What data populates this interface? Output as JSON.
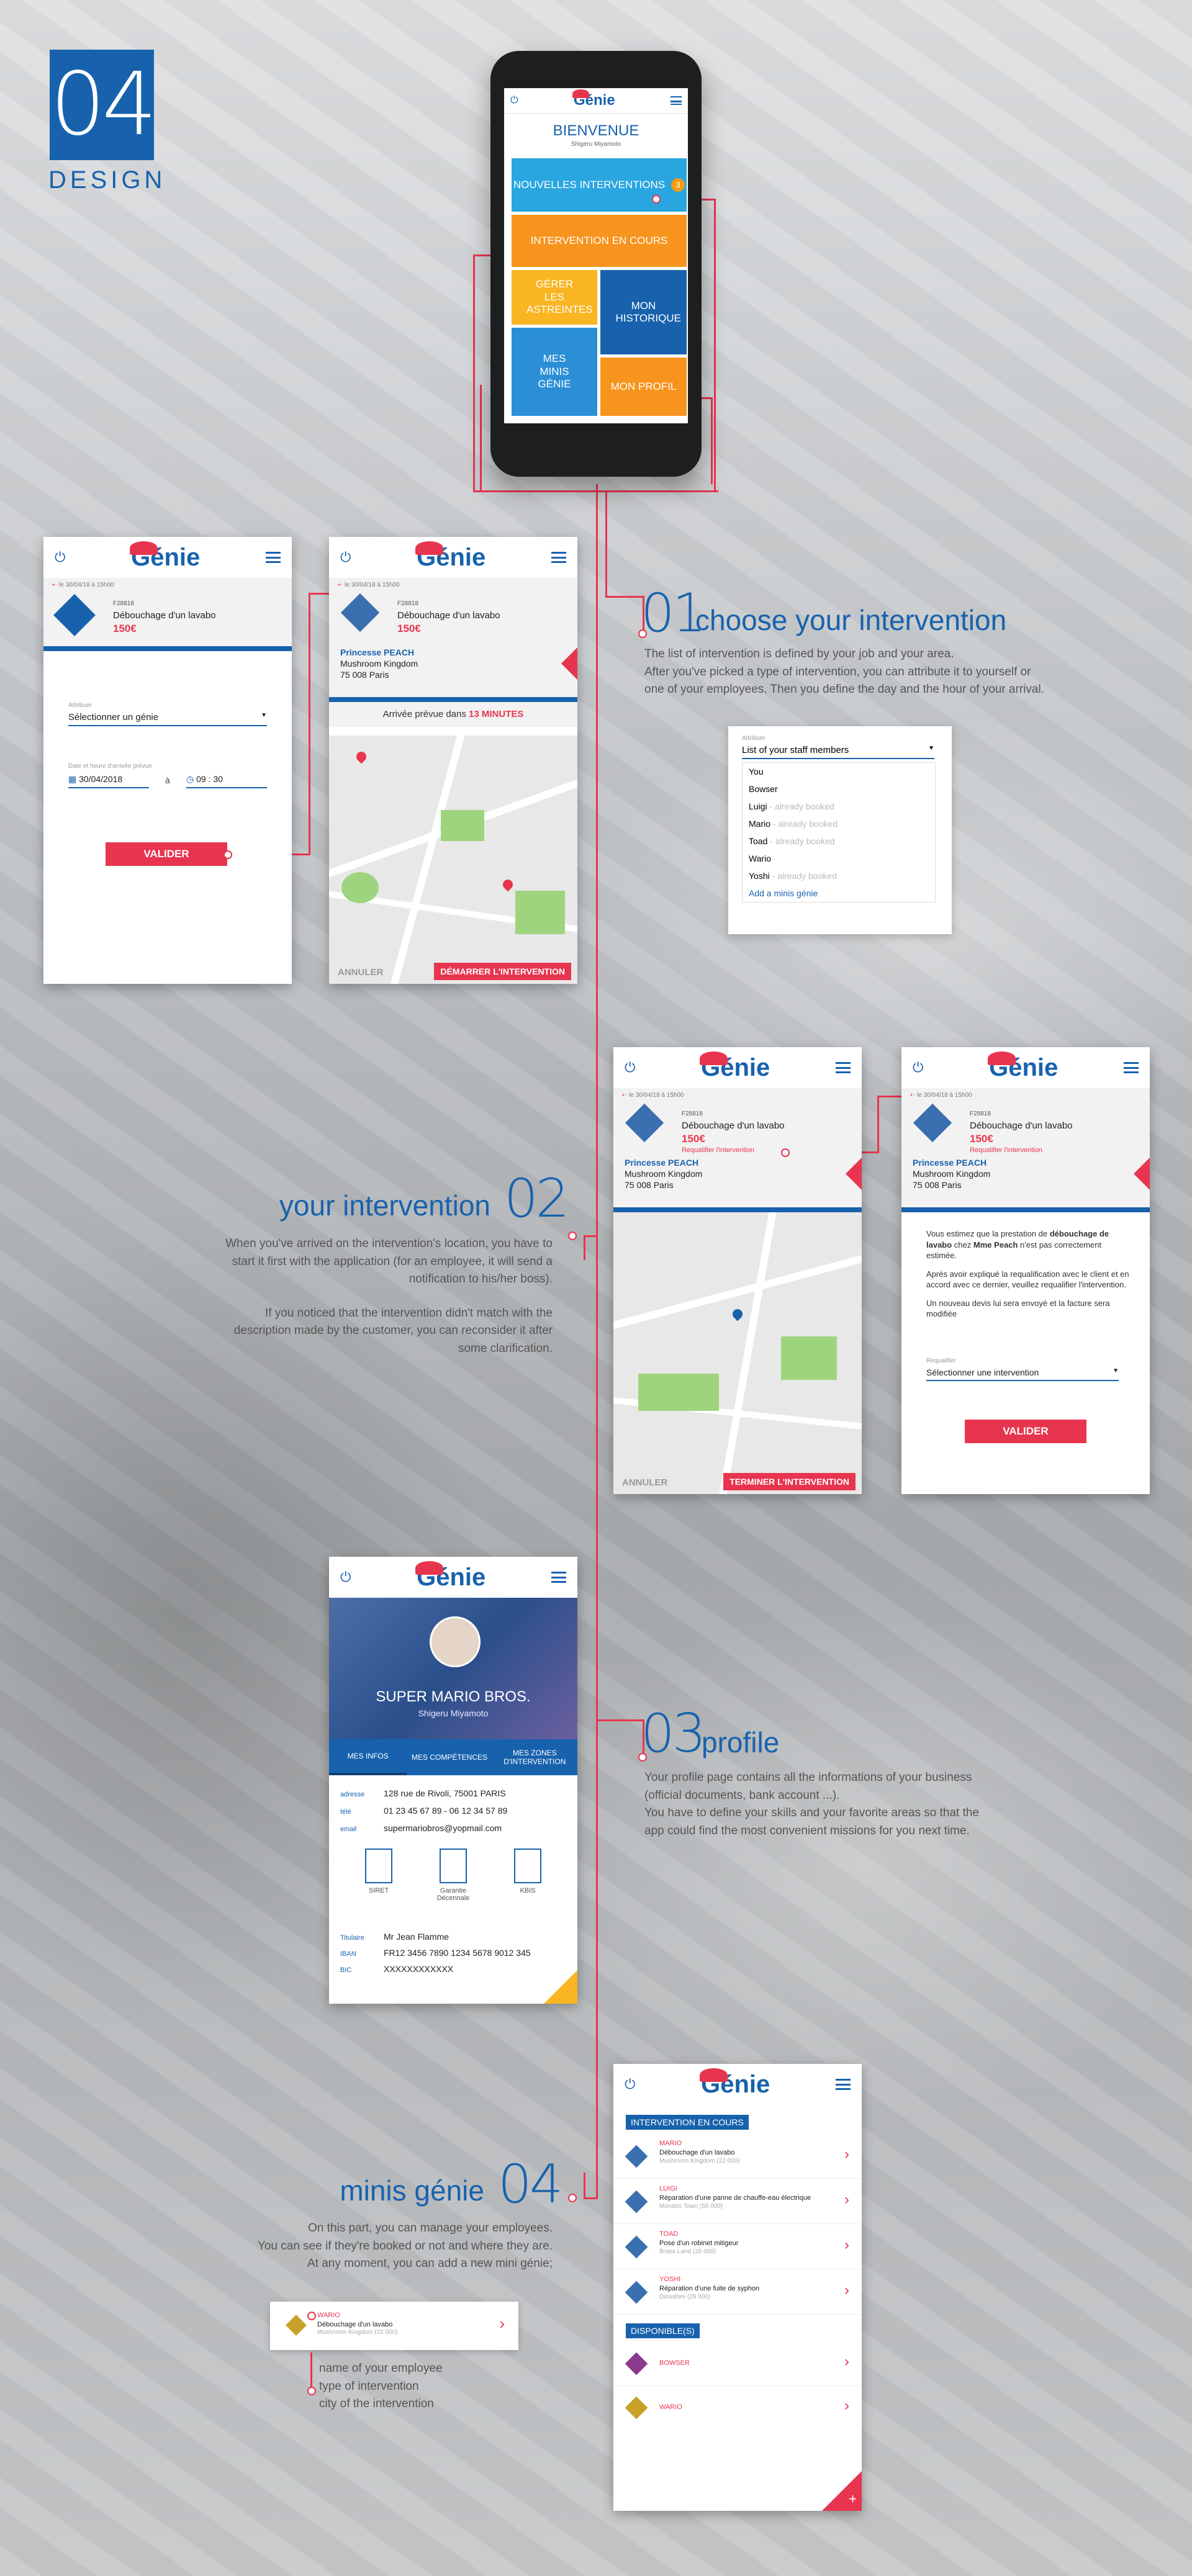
{
  "header": {
    "number": "04",
    "label": "DESIGN"
  },
  "brand": {
    "logo": "Génie",
    "accent": "#e8354f",
    "primary": "#1862ad"
  },
  "phone": {
    "welcome": "BIENVENUE",
    "user": "Shigeru Miyamoto",
    "tiles": {
      "new_interventions": "NOUVELLES INTERVENTIONS",
      "new_badge": "3",
      "in_progress": "INTERVENTION EN COURS",
      "manage_on_call": "GÉRER LES ASTREINTES",
      "history": "MON HISTORIQUE",
      "minis": "MES MINIS GÉNIE",
      "profile": "MON PROFIL"
    }
  },
  "section1": {
    "num": "01",
    "title": "choose your intervention",
    "lines": [
      "The list of intervention is defined by your job and your area.",
      "After you've picked a type of intervention, you can attribute it to yourself or",
      "one of your employees. Then you define the day and the hour of your arrival."
    ],
    "dropdown": {
      "label": "Attribuer",
      "selected": "List of your staff members",
      "options": [
        {
          "name": "You",
          "note": ""
        },
        {
          "name": "Bowser",
          "note": ""
        },
        {
          "name": "Luigi",
          "note": " - already booked"
        },
        {
          "name": "Mario",
          "note": " - already booked"
        },
        {
          "name": "Toad",
          "note": " - already booked"
        },
        {
          "name": "Wario",
          "note": ""
        },
        {
          "name": "Yoshi",
          "note": " - already booked"
        }
      ],
      "add": "Add a minis génie"
    }
  },
  "job": {
    "date": "le 30/04/18 à 15h00",
    "id": "F28818",
    "title": "Débouchage d'un lavabo",
    "price": "150€",
    "requalify": "Requalifier l'intervention"
  },
  "client": {
    "name": "Princesse PEACH",
    "line1": "Mushroom Kingdom",
    "line2": "75 008 Paris"
  },
  "screen_assign": {
    "assign_label": "Attribuer",
    "assign_value": "Sélectionner un génie",
    "date_label": "Date et heure d'arrivée prévue",
    "date": "30/04/2018",
    "a": "à",
    "time": "09 : 30",
    "submit": "VALIDER"
  },
  "screen_eta": {
    "eta_prefix": "Arrivée prévue dans",
    "eta": "13 MINUTES",
    "cancel": "ANNULER",
    "start": "DÉMARRER L'INTERVENTION"
  },
  "screen_finish": {
    "cancel": "ANNULER",
    "finish": "TERMINER L'INTERVENTION"
  },
  "screen_requalify": {
    "p1a": "Vous estimez que la prestation de ",
    "p1b": "débouchage de lavabo",
    "p1c": " chez ",
    "p1d": "Mme Peach",
    "p1e": " n'est pas correctement estimée.",
    "p2": "Après avoir expliqué la requalification avec le client et en accord avec ce dernier, veuillez requalifier l'intervention.",
    "p3": "Un nouveau devis lui sera envoyé et la facture sera modifiée",
    "field_label": "Requalifier",
    "field_value": "Sélectionner une intervention",
    "submit": "VALIDER"
  },
  "section2": {
    "num": "02",
    "title": "your intervention",
    "lines1": [
      "When you've arrived on the intervention's location, you have to",
      "start it first with the application (for an employee, it will send a",
      "notification to his/her boss)."
    ],
    "lines2": [
      "If you noticed that the intervention didn't match with the",
      "description made by the customer, you can reconsider it after",
      "some clarification."
    ]
  },
  "profile": {
    "company": "SUPER MARIO BROS.",
    "owner": "Shigeru Miyamoto",
    "tabs": [
      "MES INFOS",
      "MES COMPÉTENCES",
      "MES ZONES D'INTERVENTION"
    ],
    "fields": [
      {
        "k": "adresse",
        "v": "128 rue de Rivoli, 75001 PARIS"
      },
      {
        "k": "télé",
        "v": "01 23 45 67 89 - 06 12 34 57 89"
      },
      {
        "k": "email",
        "v": "supermariobros@yopmail.com"
      }
    ],
    "docs": [
      "SIRET",
      "Garantie Décennale",
      "KBIS"
    ],
    "bank": [
      {
        "k": "Titulaire",
        "v": "Mr Jean Flamme"
      },
      {
        "k": "IBAN",
        "v": "FR12 3456 7890 1234 5678 9012 345"
      },
      {
        "k": "BIC",
        "v": "XXXXXXXXXXXX"
      }
    ]
  },
  "section3": {
    "num": "03",
    "title": "profile",
    "lines": [
      "Your profile page contains all the informations of your business",
      "(official documents, bank account ...).",
      "You have to define your skills and your favorite areas so that the",
      "app could find the most convenient missions for you next time."
    ]
  },
  "minis_screen": {
    "in_progress": "INTERVENTION EN COURS",
    "available": "DISPONIBLE(S)",
    "items": [
      {
        "name": "MARIO",
        "job": "Débouchage d'un lavabo",
        "city": "Mushroom Kingdom (22 000)"
      },
      {
        "name": "LUIGI",
        "job": "Réparation d'une panne de chauffe-eau électrique",
        "city": "Monstro Town (56 000)"
      },
      {
        "name": "TOAD",
        "job": "Pose d'un robinet mitigeur",
        "city": "Brasa Land (35 000)"
      },
      {
        "name": "YOSHI",
        "job": "Réparation d'une fuite de syphon",
        "city": "Dinoshire (29 000)"
      }
    ],
    "available_items": [
      "BOWSER",
      "WARIO"
    ]
  },
  "section4": {
    "num": "04",
    "title": "minis génie",
    "lines": [
      "On this part, you can manage your employees.",
      "You can see if they're booked or not and where they are.",
      "At any moment, you can add a new mini génie;"
    ],
    "sample": {
      "name": "WARIO",
      "job": "Débouchage d'un lavabo",
      "city": "Mushroom Kingdom (22 000)"
    },
    "legend": [
      "name of your employee",
      "type of intervention",
      "city of the intervention"
    ]
  }
}
